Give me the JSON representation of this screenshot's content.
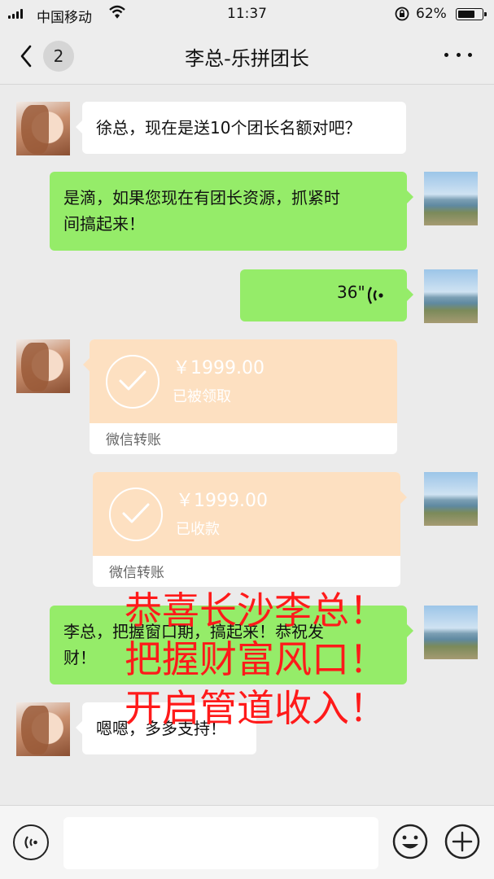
{
  "status_bar": {
    "carrier": "中国移动",
    "time": "11:37",
    "battery_percent": "62%",
    "battery_level": 0.62,
    "icons": [
      "signal-icon",
      "wifi-icon",
      "rotation-lock-icon",
      "battery-icon"
    ]
  },
  "nav": {
    "back_icon": "chevron-left-icon",
    "unread_count": "2",
    "title": "李总-乐拼团长",
    "more_icon": "more-dots-icon"
  },
  "messages": [
    {
      "side": "left",
      "type": "text",
      "text": "徐总，现在是送10个团长名额对吧？"
    },
    {
      "side": "right",
      "type": "text",
      "lines": [
        "是滴，如果您现在有团长资源，抓紧时",
        "间搞起来！"
      ]
    },
    {
      "side": "right",
      "type": "voice",
      "duration": "36\""
    },
    {
      "side": "left",
      "type": "transfer",
      "amount": "￥1999.00",
      "status": "已被领取",
      "footer": "微信转账"
    },
    {
      "side": "right",
      "type": "transfer",
      "amount": "￥1999.00",
      "status": "已收款",
      "footer": "微信转账"
    },
    {
      "side": "right",
      "type": "text",
      "lines": [
        "李总，把握窗口期，搞起来！恭祝发",
        "财！"
      ]
    },
    {
      "side": "left",
      "type": "text",
      "text": "嗯嗯，多多支持！"
    }
  ],
  "overlay_text": [
    "恭喜长沙李总！",
    "把握财富风口！",
    "开启管道收入！"
  ],
  "colors": {
    "background": "#ebebeb",
    "sent_bubble": "#95ec69",
    "received_bubble": "#ffffff",
    "transfer_card": "#fde0c1",
    "overlay": "#ff1a1a"
  },
  "input_bar": {
    "icons": [
      "voice-input-icon",
      "emoji-icon",
      "plus-icon"
    ]
  }
}
